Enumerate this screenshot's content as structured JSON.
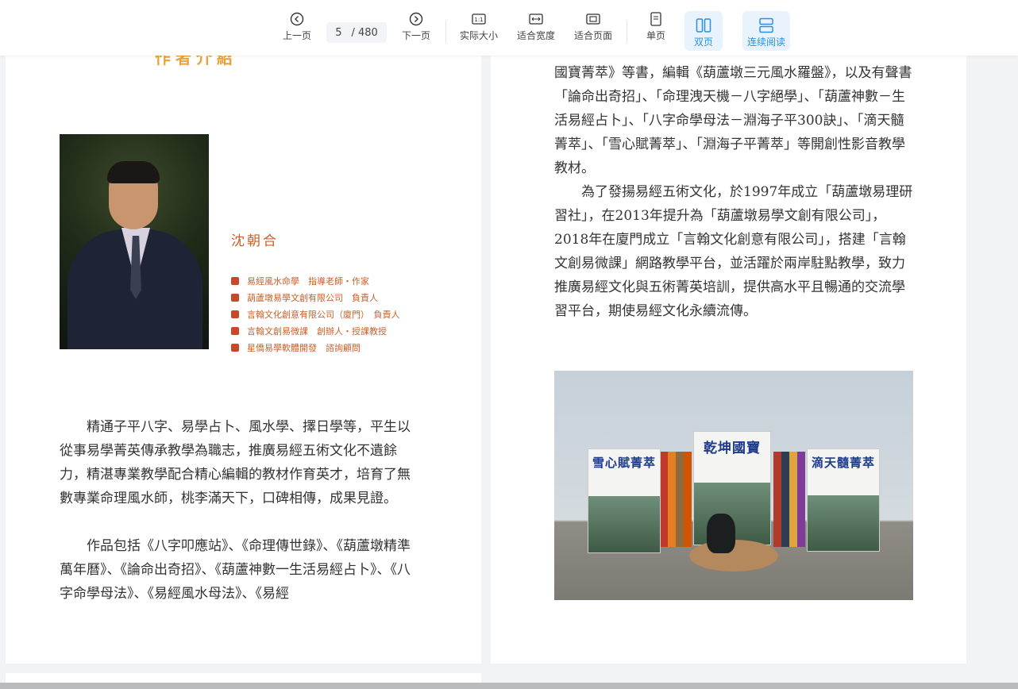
{
  "toolbar": {
    "prev_label": "上一页",
    "page_current": "5",
    "page_total": "/ 480",
    "next_label": "下一页",
    "actual_size_label": "实际大小",
    "actual_size_icon_text": "1:1",
    "fit_width_label": "适合宽度",
    "fit_page_label": "适合页面",
    "single_page_label": "单页",
    "double_page_label": "双页",
    "continuous_label": "连续阅读",
    "active_color": "#2b8ee6"
  },
  "left_page": {
    "heading_fragment": "作者介紹",
    "author_name": "沈朝合",
    "bio_items": [
      "易經風水命學　指導老師・作家",
      "葫蘆墩易學文創有限公司　負責人",
      "言翰文化創意有限公司（廈門）　負責人",
      "言翰文創易微課　創辦人・授課教授",
      "星僑易學軟體開發　諮詢顧問"
    ],
    "paragraph_1": "精通子平八字、易學占卜、風水學、擇日學等，平生以從事易學菁英傳承教學為職志，推廣易經五術文化不遺餘力，精湛專業教學配合精心編輯的教材作育英才，培育了無數專業命理風水師，桃李滿天下，口碑相傳，成果見證。",
    "paragraph_2": "作品包括《八字叩應站》、《命理傳世錄》、《葫蘆墩精準萬年曆》、《論命出奇招》、《葫蘆神數一生活易經占卜》、《八字命學母法》、《易經風水母法》、《易經"
  },
  "right_page": {
    "paragraph_1": "國寶菁萃》等書，編輯《葫蘆墩三元風水羅盤》，以及有聲書「論命出奇招」、「命理洩天機－八字絕學」、「葫蘆神數－生活易經占卜」、「八字命學母法－淵海子平300訣」、「滴天髓菁萃」、「雪心賦菁萃」、「淵海子平菁萃」等開創性影音教學教材。",
    "paragraph_2": "為了發揚易經五術文化，於1997年成立「葫蘆墩易理研習社」，在2013年提升為「葫蘆墩易學文創有限公司」，2018年在廈門成立「言翰文化創意有限公司」，搭建「言翰文創易微課」網路教學平台，並活躍於兩岸駐點教學，致力推廣易經文化與五術菁英培訓，提供高水平且暢通的交流學習平台，期使易經文化永續流傳。",
    "book_titles": [
      "雪心賦菁萃",
      "乾坤國寶",
      "滴天髓菁萃"
    ]
  }
}
